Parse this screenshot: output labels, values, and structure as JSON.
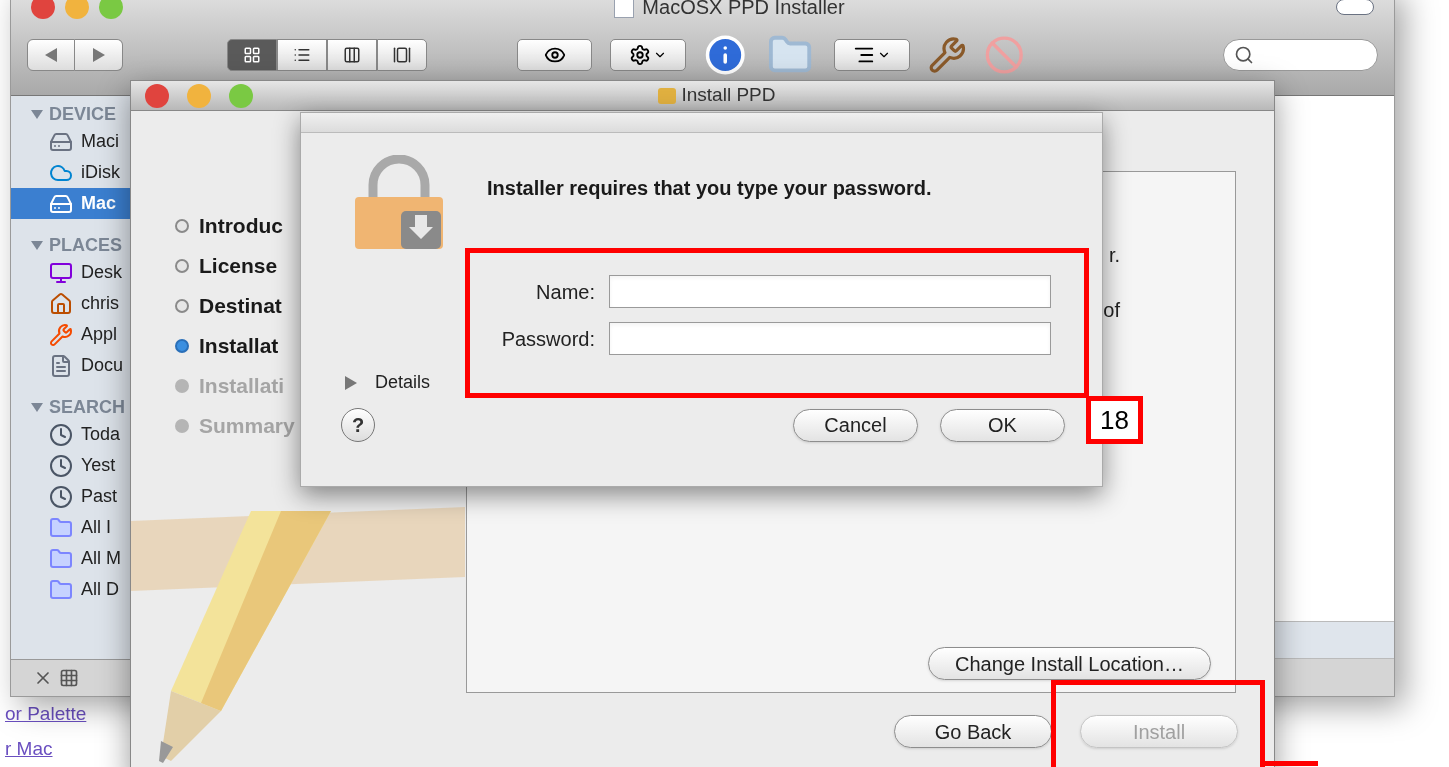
{
  "background_links": [
    "or Palette",
    "r Mac"
  ],
  "finder": {
    "title": "MacOSX PPD Installer",
    "view_modes": [
      {
        "kind": "icons",
        "selected": true
      },
      {
        "kind": "list",
        "selected": false
      },
      {
        "kind": "columns",
        "selected": false
      },
      {
        "kind": "coverflow",
        "selected": false
      }
    ],
    "sidebar": [
      {
        "title": "DEVICE",
        "items": [
          {
            "label": "Maci",
            "kind": "disk",
            "selected": false
          },
          {
            "label": "iDisk",
            "kind": "idisk",
            "selected": false
          },
          {
            "label": "Mac",
            "kind": "drive",
            "selected": true
          }
        ]
      },
      {
        "title": "PLACES",
        "items": [
          {
            "label": "Desk",
            "kind": "desktop",
            "selected": false
          },
          {
            "label": "chris",
            "kind": "home",
            "selected": false
          },
          {
            "label": "Appl",
            "kind": "apps",
            "selected": false
          },
          {
            "label": "Docu",
            "kind": "docs",
            "selected": false
          }
        ]
      },
      {
        "title": "SEARCH",
        "items": [
          {
            "label": "Toda",
            "kind": "clock",
            "selected": false
          },
          {
            "label": "Yest",
            "kind": "clock",
            "selected": false
          },
          {
            "label": "Past",
            "kind": "clock",
            "selected": false
          },
          {
            "label": "All I",
            "kind": "smart",
            "selected": false
          },
          {
            "label": "All M",
            "kind": "smart",
            "selected": false
          },
          {
            "label": "All D",
            "kind": "smart",
            "selected": false
          }
        ]
      }
    ]
  },
  "installer": {
    "title": "Install PPD",
    "steps": [
      {
        "label": "Introduc",
        "done": true,
        "selected": false
      },
      {
        "label": "License",
        "done": true,
        "selected": false
      },
      {
        "label": "Destinat",
        "done": true,
        "selected": false
      },
      {
        "label": "Installat",
        "done": false,
        "selected": true
      },
      {
        "label": "Installati",
        "done": false,
        "selected": false
      },
      {
        "label": "Summary",
        "done": false,
        "selected": false
      }
    ],
    "body_fragments": [
      "r.",
      "of"
    ],
    "change_location_button": "Change Install Location…",
    "buttons": [
      {
        "label": "Go Back",
        "disabled": false
      },
      {
        "label": "Install",
        "disabled": true
      }
    ]
  },
  "dialog": {
    "message": "Installer requires that you type your password.",
    "fields": [
      {
        "label": "Name:"
      },
      {
        "label": "Password:"
      }
    ],
    "details": {
      "label": "Details",
      "expanded": false
    },
    "help": "?",
    "buttons": [
      "Cancel",
      "OK"
    ]
  },
  "annotation": {
    "label": "18"
  }
}
